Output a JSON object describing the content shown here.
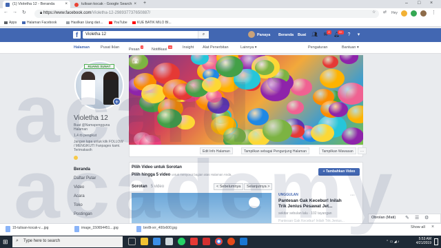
{
  "browser": {
    "tabs": [
      {
        "label": "(1) Violetha 12 - Beranda",
        "active": true
      },
      {
        "label": "tulisan kocak - Google Search",
        "active": false
      }
    ],
    "url": "https://www.facebook.com/Violetha-12-298937737650887/",
    "url_host": "https://www.facebook.com",
    "url_path": "/Violetha-12-298937737650887/",
    "bookmarks": [
      {
        "label": "Apps",
        "icon": "apps-icon"
      },
      {
        "label": "Halaman Facebook",
        "icon": "facebook-icon"
      },
      {
        "label": "Hasilkan Uang dari...",
        "icon": "bookmark-icon"
      },
      {
        "label": "YouTube",
        "icon": "youtube-icon"
      },
      {
        "label": "KUE BATIK MILO BI...",
        "icon": "youtube-icon"
      }
    ],
    "ext_text": "Hey"
  },
  "fb_header": {
    "search_value": "Violetha 12",
    "user_name": "Panaya",
    "nav": [
      "Beranda",
      "Buat"
    ],
    "badges": {
      "friends": "",
      "messages": "2",
      "notifications": "9+"
    }
  },
  "page_tabs": {
    "items": [
      {
        "label": "Halaman",
        "active": true
      },
      {
        "label": "Pusat Iklan",
        "active": false
      },
      {
        "label": "Pesan",
        "badge": "2"
      },
      {
        "label": "Notifikasi",
        "badge": "10"
      },
      {
        "label": "Insight",
        "active": false
      },
      {
        "label": "Alat Penerbitan",
        "active": false
      },
      {
        "label": "Lainnya ▾",
        "active": false
      }
    ],
    "right": [
      "Pengaturan",
      "Bantuan ▾"
    ]
  },
  "profile": {
    "avatar_label": "RUANG SUNAT",
    "name": "Violetha 12",
    "handle": "Buat @Namapengguna",
    "handle2": "Halaman",
    "likes": "1,4 rb pengikut",
    "desc": "Jangan lupa untuk klik FOLLOW / MENGIKUTI Fanpages kami. Terimakasih",
    "left_nav": [
      {
        "label": "Beranda",
        "active": true
      },
      {
        "label": "Daftar Putar",
        "active": false
      },
      {
        "label": "Video",
        "active": false
      },
      {
        "label": "Acara",
        "active": false
      },
      {
        "label": "Toko",
        "active": false
      },
      {
        "label": "Postingan",
        "active": false
      }
    ]
  },
  "cover_actions": [
    "Edit Info Halaman",
    "Tampilkan sebagai Pengunjung Halaman",
    "Tampilkan Wawasan",
    "···"
  ],
  "video_section": {
    "heading": "Pilih Video untuk Sorotan",
    "sub": "Pilih hingga 5 video",
    "sub_note": "untuk menyorot bagian atas Halaman Anda.",
    "add_button": "+ Tambahkan Video",
    "sorotan_label": "Sorotan",
    "sorotan_count": "5 video",
    "prev": "< Sebelumnya",
    "next": "Selanjutnya >",
    "featured_tag": "UNGGULAN",
    "featured_title": "Pantesan Gak Kecebur! Inilah Trik Jenius Pesawat Jet...",
    "featured_meta": "sekitar sebulan lalu · 102 tayangan",
    "featured_meta2": "Pantesan Gak Kecebur! Inilah Trik Jenius..."
  },
  "chat": {
    "label": "Obrolan (Mati)"
  },
  "downloads": {
    "items": [
      "15-tulisan-kocak-v....jpg",
      "image_150654451....jpg",
      "bnr8t-xrr_400x600.jpg"
    ],
    "show_all": "Show all"
  },
  "taskbar": {
    "search_placeholder": "Type here to search",
    "time": "5:53 AM",
    "date": "4/21/2019"
  },
  "watermark": {
    "line1": "acard",
    "line2": "academy"
  }
}
